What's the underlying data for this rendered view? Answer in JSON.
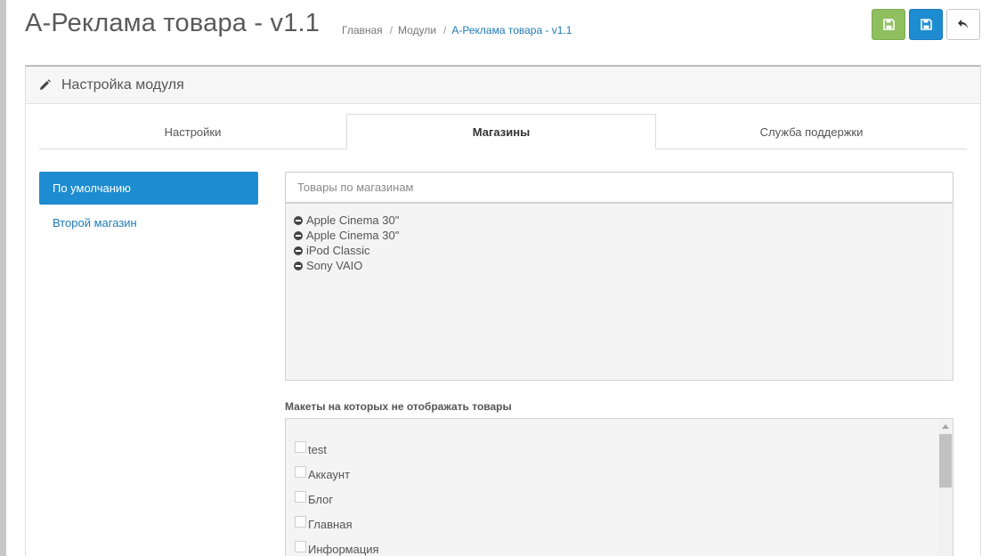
{
  "header": {
    "title": "А-Реклама товара - v1.1",
    "breadcrumb": [
      "Главная",
      "Модули",
      "А-Реклама товара - v1.1"
    ]
  },
  "toolbar": {
    "save_stay_icon": "save-icon",
    "save_icon": "save-icon",
    "back_icon": "reply-icon"
  },
  "panel": {
    "icon": "pencil-icon",
    "title": "Настройка модуля"
  },
  "tabs": [
    {
      "label": "Настройки",
      "active": false
    },
    {
      "label": "Магазины",
      "active": true
    },
    {
      "label": "Служба поддержки",
      "active": false
    }
  ],
  "stores": [
    {
      "label": "По умолчанию",
      "active": true
    },
    {
      "label": "Второй магазин",
      "active": false
    }
  ],
  "products": {
    "placeholder": "Товары по магазинам",
    "items": [
      "Apple Cinema 30\"",
      "Apple Cinema 30\"",
      "iPod Classic",
      "Sony VAIO"
    ]
  },
  "layouts": {
    "label": "Макеты на которых не отображать товары",
    "items": [
      "test",
      "Аккаунт",
      "Блог",
      "Главная",
      "Информация"
    ]
  },
  "colors": {
    "primary": "#1e8cd1",
    "success": "#8fbf5f",
    "link": "#1e7bb8"
  }
}
